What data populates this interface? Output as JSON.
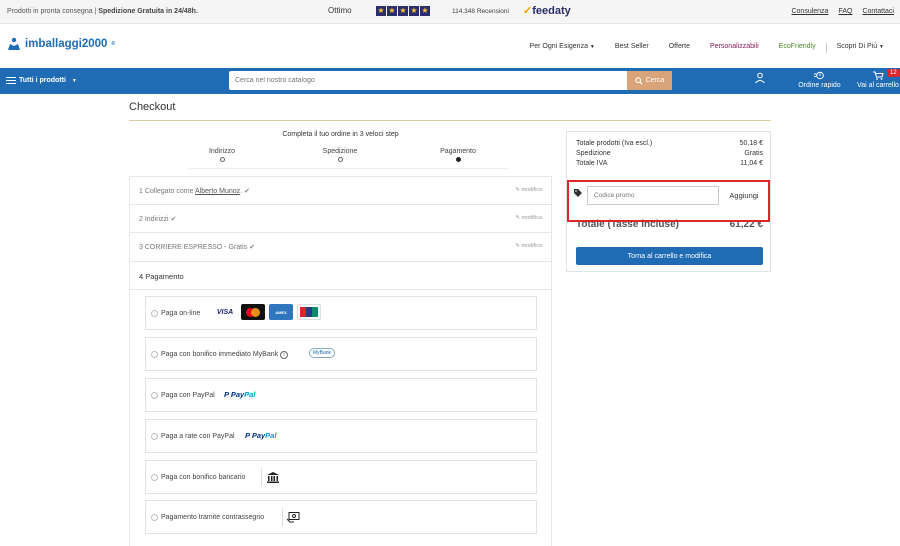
{
  "topbar": {
    "left_text": "Prodotti in pronta consegna | ",
    "left_bold": "Spedizione Gratuita in 24/48h.",
    "rating_word": "Ottimo",
    "reviews": "114.348 Recensioni",
    "feedaty": "feedaty",
    "links": [
      "Consulenza",
      "FAQ",
      "Contattaci"
    ]
  },
  "header": {
    "logo": "imballaggi2000",
    "nav": [
      "Per Ogni Esigenza",
      "Best Seller",
      "Offerte",
      "Personalizzabili",
      "EcoFriendly",
      "Scopri Di Più"
    ]
  },
  "bluebar": {
    "menu_label": "Tutti i prodotti",
    "search_placeholder": "Cerca nel nostro catalogo",
    "search_button": "Cerca",
    "quick_order": "Ordine rapido",
    "cart_label": "Vai al carrello",
    "cart_count": "12"
  },
  "checkout": {
    "title": "Checkout",
    "steps_title": "Completa il tuo ordine in 3 veloci step",
    "steps": [
      "Indirizzo",
      "Spedizione",
      "Pagamento"
    ],
    "sections": {
      "s1_prefix": "1 Collegato come ",
      "s1_user": "Alberto Munoz",
      "s1_suffix": ".",
      "s2": "2 Indirizzi",
      "s3": "3 CORRIERE ESPRESSO - Gratis",
      "modify": "modifica",
      "s4": "4 Pagamento"
    },
    "payment_methods": [
      "Paga on-line",
      "Paga con bonifico immediato MyBank",
      "Paga con PayPal",
      "Paga a rate con PayPal",
      "Paga con bonifico bancario",
      "Pagamento tramite contrassegno"
    ],
    "logos": {
      "visa": "VISA",
      "amex": "AMEX",
      "mybank": "MyBank",
      "paypal_a": "Pay",
      "paypal_b": "Pal"
    }
  },
  "summary": {
    "rows": [
      {
        "label": "Totale prodotti (Iva escl.)",
        "value": "50,18 €"
      },
      {
        "label": "Spedizione",
        "value": "Gratis"
      },
      {
        "label": "Totale IVA",
        "value": "11,04 €"
      }
    ],
    "promo_placeholder": "Codice promo",
    "promo_button": "Aggiungi",
    "total_label": "Totale (Tasse incluse)",
    "total_value": "61,22 €",
    "cart_button": "Torna al carrello e modifica"
  },
  "colors": {
    "brand_blue": "#1f6cb5",
    "search_button": "#d9a47a",
    "highlight_red": "#d9272e"
  }
}
